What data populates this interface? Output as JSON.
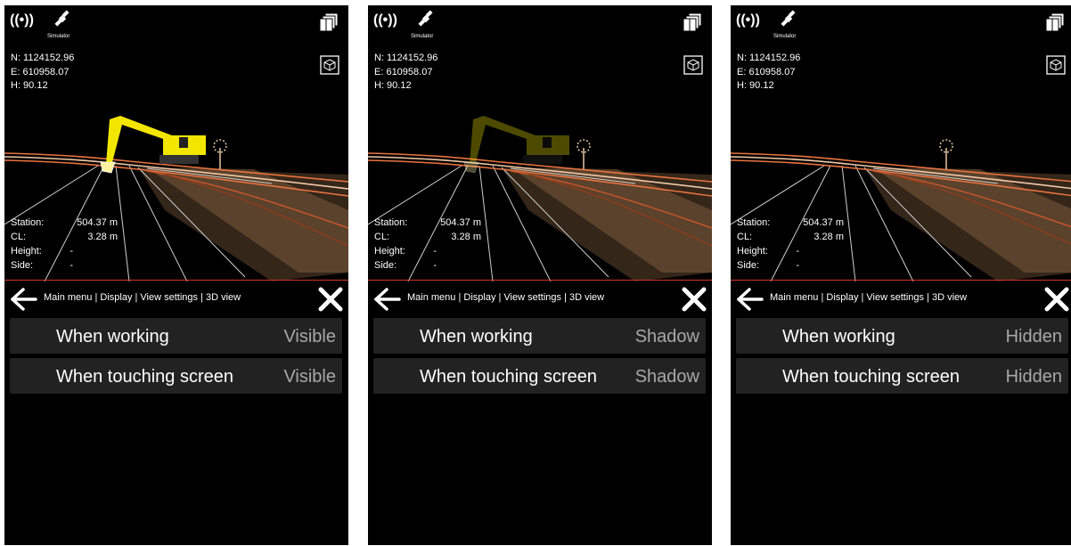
{
  "panels": [
    {
      "status": {
        "gnss_icon": "((•))",
        "sim_label": "Simulator"
      },
      "coords": {
        "n": "N: 1124152.96",
        "e": "E: 610958.07",
        "h": "H: 90.12"
      },
      "readout": {
        "station_label": "Station:",
        "station_value": "504.37 m",
        "cl_label": "CL:",
        "cl_value": "3.28 m",
        "height_label": "Height:",
        "height_value": "-",
        "side_label": "Side:",
        "side_value": "-"
      },
      "breadcrumb": "Main menu | Display | View settings | 3D view",
      "settings": [
        {
          "label": "When working",
          "value": "Visible"
        },
        {
          "label": "When touching screen",
          "value": "Visible"
        }
      ],
      "machine_display": "visible"
    },
    {
      "status": {
        "gnss_icon": "((•))",
        "sim_label": "Simulator"
      },
      "coords": {
        "n": "N: 1124152.96",
        "e": "E: 610958.07",
        "h": "H: 90.12"
      },
      "readout": {
        "station_label": "Station:",
        "station_value": "504.37 m",
        "cl_label": "CL:",
        "cl_value": "3.28 m",
        "height_label": "Height:",
        "height_value": "-",
        "side_label": "Side:",
        "side_value": "-"
      },
      "breadcrumb": "Main menu | Display | View settings | 3D view",
      "settings": [
        {
          "label": "When working",
          "value": "Shadow"
        },
        {
          "label": "When touching screen",
          "value": "Shadow"
        }
      ],
      "machine_display": "shadow"
    },
    {
      "status": {
        "gnss_icon": "((•))",
        "sim_label": "Simulator"
      },
      "coords": {
        "n": "N: 1124152.96",
        "e": "E: 610958.07",
        "h": "H: 90.12"
      },
      "readout": {
        "station_label": "Station:",
        "station_value": "504.37 m",
        "cl_label": "CL:",
        "cl_value": "3.28 m",
        "height_label": "Height:",
        "height_value": "-",
        "side_label": "Side:",
        "side_value": "-"
      },
      "breadcrumb": "Main menu | Display | View settings | 3D view",
      "settings": [
        {
          "label": "When working",
          "value": "Hidden"
        },
        {
          "label": "When touching screen",
          "value": "Hidden"
        }
      ],
      "machine_display": "hidden"
    }
  ],
  "icons": [
    "gnss-signal-icon",
    "satellite-icon",
    "layers-icon",
    "cube-icon",
    "back-arrow-icon",
    "close-icon"
  ],
  "colors": {
    "machine": "#f2e600",
    "road_line": "#e0673a",
    "road_surface": "#8a6a48",
    "panel_bg": "#000000",
    "row_bg": "#222222",
    "value_text": "#a8a8a8"
  }
}
